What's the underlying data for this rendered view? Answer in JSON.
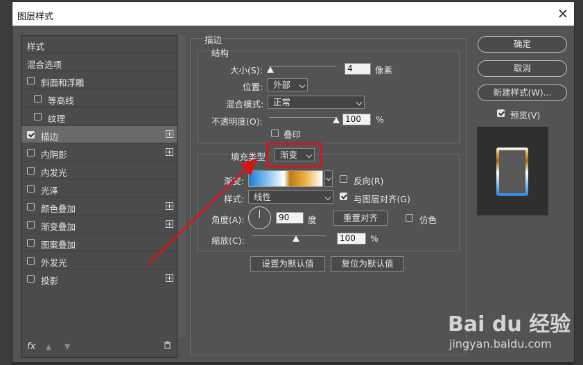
{
  "dialog": {
    "title": "图层样式",
    "close": "×"
  },
  "left_panel": {
    "header": "样式",
    "blend_options": "混合选项",
    "items": [
      {
        "label": "斜面和浮雕",
        "checked": false,
        "plus": false
      },
      {
        "label": "等高线",
        "checked": false,
        "plus": false
      },
      {
        "label": "纹理",
        "checked": false,
        "plus": false
      },
      {
        "label": "描边",
        "checked": true,
        "plus": true
      },
      {
        "label": "内阴影",
        "checked": false,
        "plus": true
      },
      {
        "label": "内发光",
        "checked": false,
        "plus": false
      },
      {
        "label": "光泽",
        "checked": false,
        "plus": false
      },
      {
        "label": "颜色叠加",
        "checked": false,
        "plus": true
      },
      {
        "label": "渐变叠加",
        "checked": false,
        "plus": true
      },
      {
        "label": "图案叠加",
        "checked": false,
        "plus": false
      },
      {
        "label": "外发光",
        "checked": false,
        "plus": false
      },
      {
        "label": "投影",
        "checked": false,
        "plus": true
      }
    ],
    "fx_label": "fx"
  },
  "stroke": {
    "section_title": "描边",
    "structure_title": "结构",
    "size_label": "大小(S):",
    "size_value": "4",
    "size_unit": "像素",
    "size_level": 0.02,
    "position_label": "位置:",
    "position_value": "外部",
    "blend_mode_label": "混合模式:",
    "blend_mode_value": "正常",
    "opacity_label": "不透明度(O):",
    "opacity_value": "100",
    "opacity_unit": "%",
    "opacity_level": 1.0,
    "overprint_label": "叠印",
    "overprint_checked": false
  },
  "fill": {
    "fill_type_label": "填充类型:",
    "fill_type_value": "渐变",
    "gradient_label": "渐变:",
    "reverse_label": "反向(R)",
    "reverse_checked": false,
    "style_label": "样式:",
    "style_value": "线性",
    "align_label": "与图层对齐(G)",
    "align_checked": true,
    "angle_label": "角度(A):",
    "angle_value": "90",
    "angle_unit": "度",
    "reset_align_button": "重置对齐",
    "dither_label": "仿色",
    "dither_checked": false,
    "scale_label": "缩放(C):",
    "scale_value": "100",
    "scale_unit": "%",
    "scale_level": 1.0
  },
  "bottom_buttons": {
    "set_default": "设置为默认值",
    "reset_default": "复位为默认值"
  },
  "right_buttons": {
    "ok": "确定",
    "cancel": "取消",
    "new_style": "新建样式(W)...",
    "preview_label": "预览(V)",
    "preview_checked": true
  },
  "watermark": {
    "logo": "Bai du 经验",
    "url": "jingyan.baidu.com"
  },
  "colors": {
    "dialog_bg": "#535353",
    "annotation_red": "#d0181c",
    "gradient_blue": "#1a7ed8",
    "gradient_gold": "#c07a10"
  }
}
